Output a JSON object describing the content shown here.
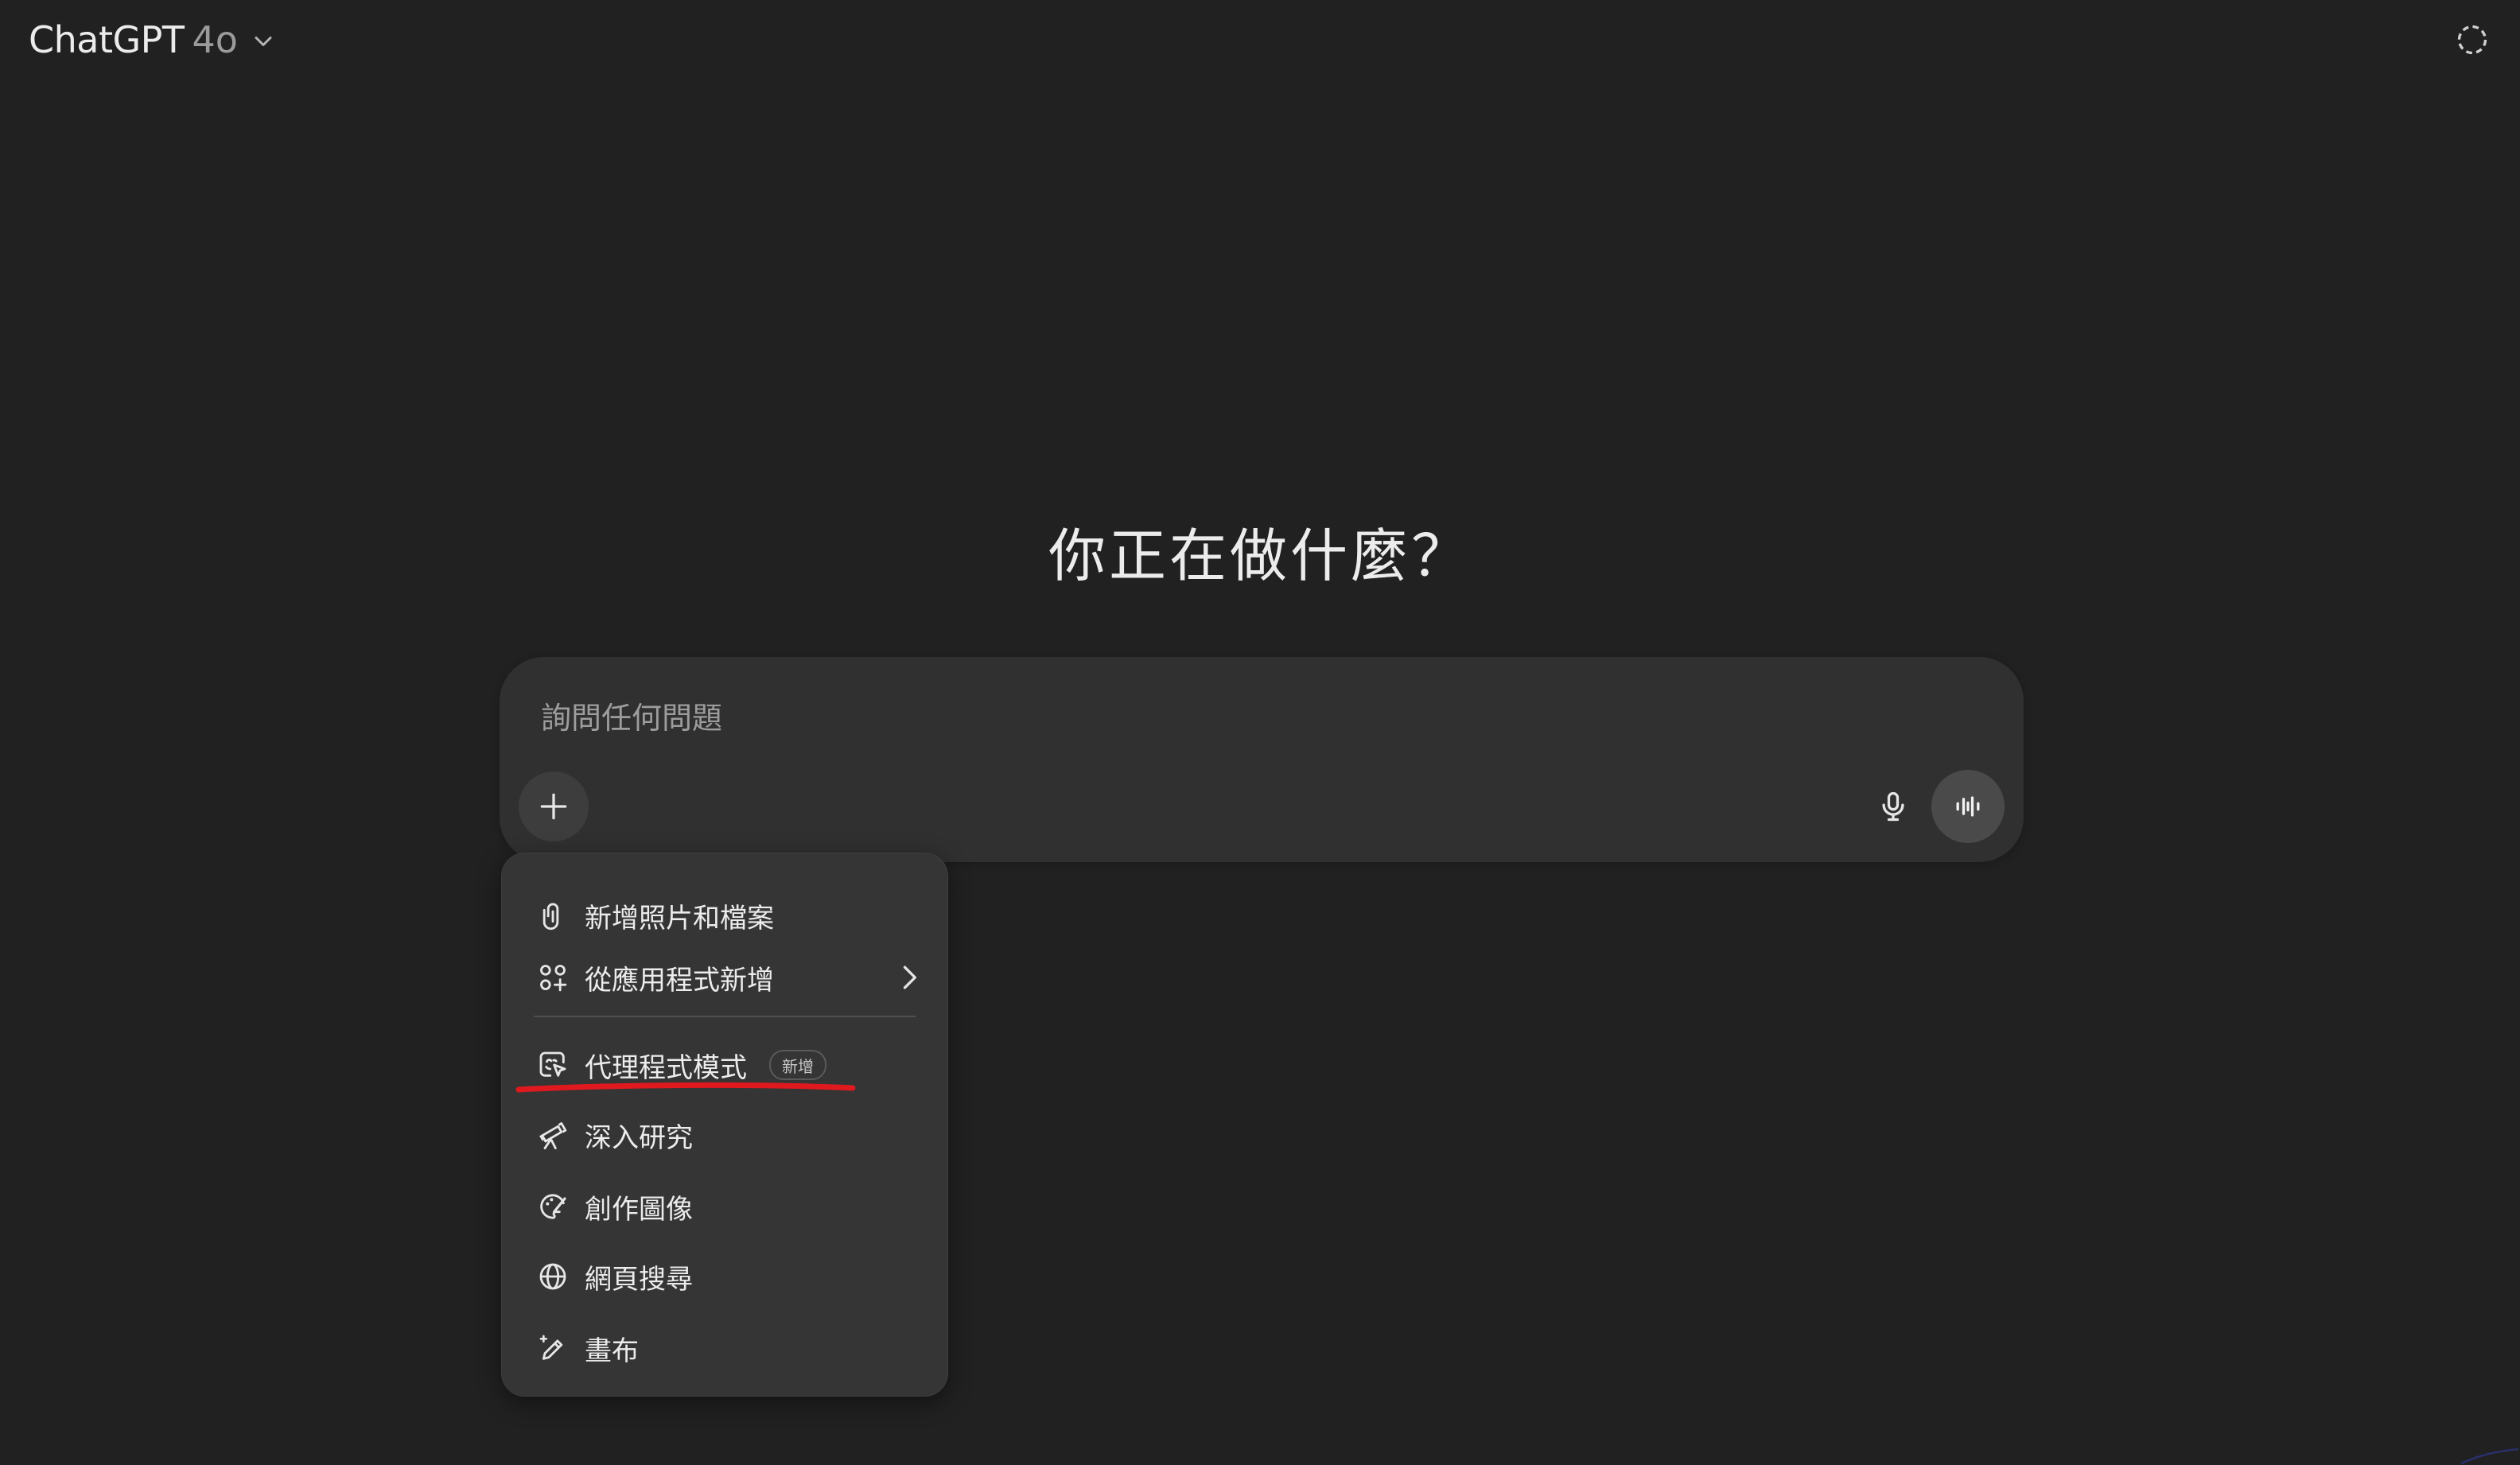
{
  "header": {
    "app_name": "ChatGPT",
    "model": "4o",
    "model_menu_icon": "chevron-down-icon",
    "temporary_chat_icon": "dashed-circle-icon"
  },
  "main": {
    "headline": "你正在做什麼？"
  },
  "composer": {
    "placeholder": "詢問任何問題",
    "value": "",
    "plus_icon": "plus-icon",
    "mic_icon": "microphone-icon",
    "voice_mode_icon": "voice-waveform-icon"
  },
  "tools_menu": {
    "items": [
      {
        "label": "新增照片和檔案",
        "icon": "paperclip-icon"
      },
      {
        "label": "從應用程式新增",
        "icon": "apps-grid-icon",
        "has_submenu": true
      },
      {
        "label": "代理程式模式",
        "icon": "agent-cursor-icon",
        "badge": "新增",
        "annotated": true
      },
      {
        "label": "深入研究",
        "icon": "telescope-icon"
      },
      {
        "label": "創作圖像",
        "icon": "palette-icon"
      },
      {
        "label": "網頁搜尋",
        "icon": "globe-icon"
      },
      {
        "label": "畫布",
        "icon": "pencil-sparkle-icon"
      }
    ]
  },
  "colors": {
    "background": "#212121",
    "composer": "#303030",
    "menu": "#353535",
    "annotation": "#e0191f"
  }
}
